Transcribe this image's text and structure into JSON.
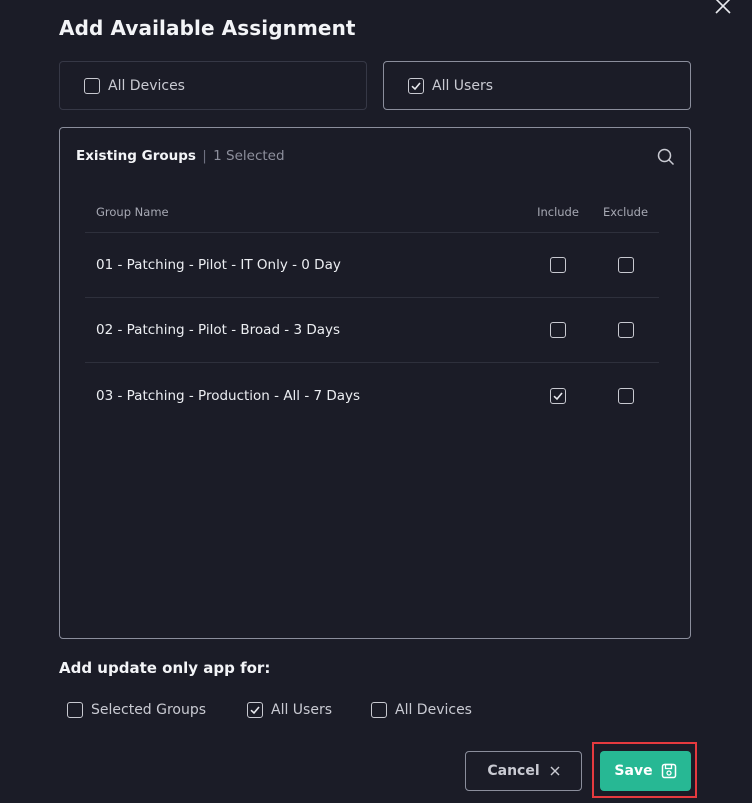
{
  "dialog": {
    "title": "Add Available Assignment"
  },
  "target_options": [
    {
      "label": "All Devices",
      "checked": false
    },
    {
      "label": "All Users",
      "checked": true
    }
  ],
  "groups": {
    "header_label": "Existing Groups",
    "separator": "|",
    "selected_text": "1 Selected",
    "columns": {
      "name": "Group Name",
      "include": "Include",
      "exclude": "Exclude"
    },
    "rows": [
      {
        "name": "01 - Patching - Pilot - IT Only - 0 Day",
        "include": false,
        "exclude": false
      },
      {
        "name": "02 - Patching - Pilot - Broad - 3 Days",
        "include": false,
        "exclude": false
      },
      {
        "name": "03 - Patching - Production - All - 7 Days",
        "include": true,
        "exclude": false
      }
    ]
  },
  "update_only": {
    "title": "Add update only app for:",
    "options": [
      {
        "label": "Selected Groups",
        "checked": false
      },
      {
        "label": "All Users",
        "checked": true
      },
      {
        "label": "All Devices",
        "checked": false
      }
    ]
  },
  "buttons": {
    "cancel_label": "Cancel",
    "save_label": "Save"
  },
  "colors": {
    "background": "#1b1c27",
    "accent": "#27b894",
    "highlight": "#e53a3f"
  }
}
